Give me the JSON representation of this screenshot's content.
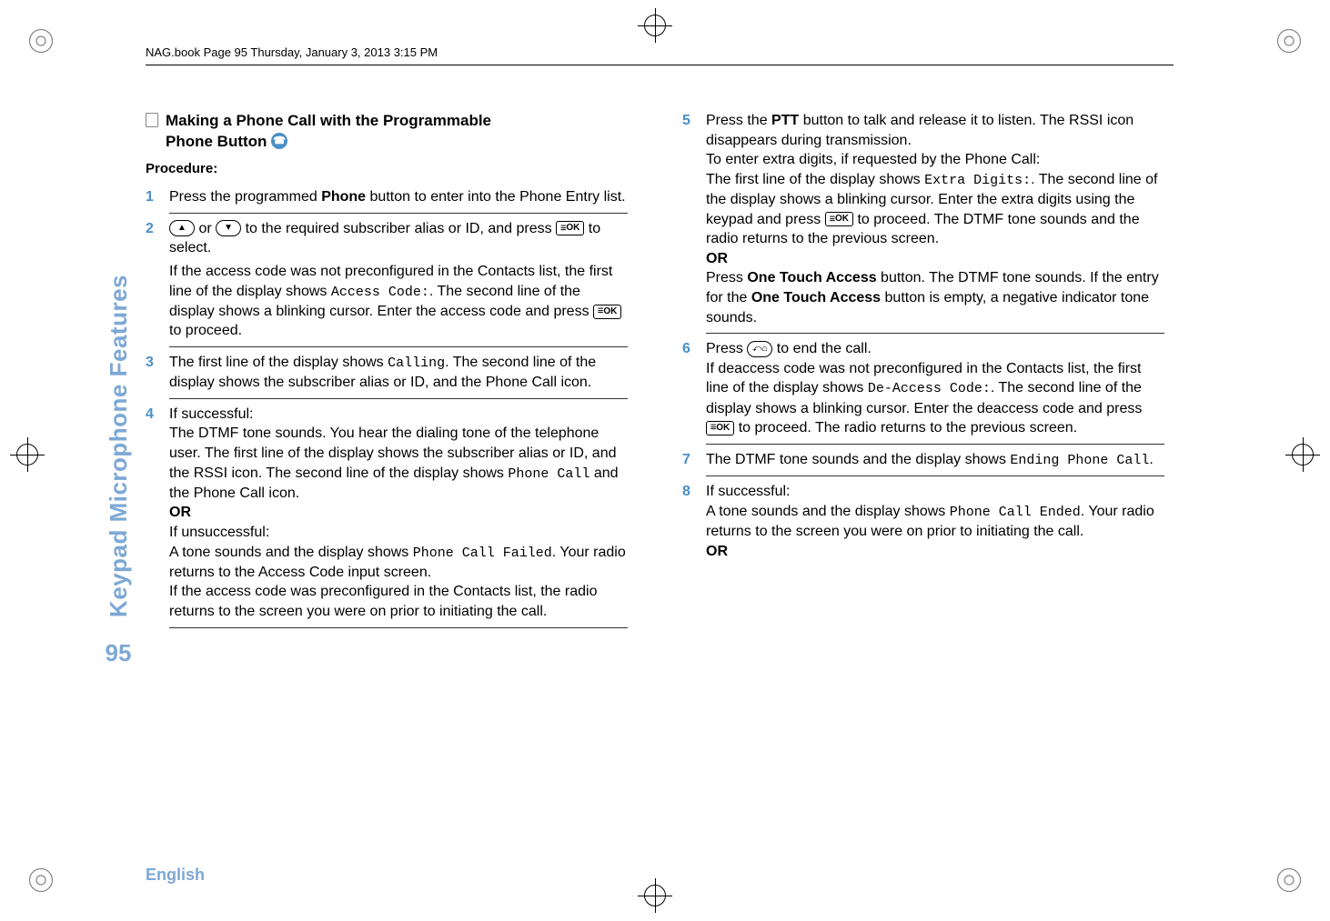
{
  "header": {
    "running_head": "NAG.book  Page 95  Thursday, January 3, 2013  3:15 PM"
  },
  "sidebar": {
    "label": "Keypad Microphone Features",
    "page_number": "95"
  },
  "footer": {
    "language": "English"
  },
  "left": {
    "title_line1": "Making a Phone Call with the Programmable",
    "title_line2": "Phone Button",
    "procedure_label": "Procedure:",
    "steps": {
      "s1": {
        "num": "1",
        "a": "Press the programmed ",
        "b_bold": "Phone",
        "c": " button to enter into the Phone Entry list."
      },
      "s2": {
        "num": "2",
        "p1a": " or ",
        "p1b": " to the required subscriber alias or ID, and press ",
        "p1c": " to select.",
        "p2a": "If the access code was not preconfigured in the Contacts list, the first line of the display shows ",
        "p2_code": "Access Code:",
        "p2b": ". The second line of the display shows a blinking cursor. Enter the access code and press ",
        "p2c": " to proceed."
      },
      "s3": {
        "num": "3",
        "a": "The first line of the display shows ",
        "code": "Calling",
        "b": ". The second line of the display shows the subscriber alias or ID, and the Phone Call icon."
      },
      "s4": {
        "num": "4",
        "heading": "If successful:",
        "p1a": "The DTMF tone sounds. You hear the dialing tone of the telephone user. The first line of the display shows the subscriber alias or ID, and the RSSI icon. The second line of the display shows ",
        "p1_code": "Phone Call",
        "p1b": " and the Phone Call icon.",
        "or": "OR",
        "p2_heading": "If unsuccessful:",
        "p3a": "A tone sounds and the display shows ",
        "p3_code": "Phone Call Failed",
        "p3b": ". Your radio returns to the Access Code input screen.",
        "p4": "If the access code was preconfigured in the Contacts list, the radio returns to the screen you were on prior to initiating the call."
      }
    }
  },
  "right": {
    "steps": {
      "s5": {
        "num": "5",
        "p1a": "Press the ",
        "p1_bold": "PTT",
        "p1b": " button to talk and release it to listen. The RSSI icon disappears during transmission.",
        "p2": "To enter extra digits, if requested by the Phone Call:",
        "p3a": "The first line of the display shows ",
        "p3_code": "Extra Digits:",
        "p3b": ". The second line of the display shows a blinking cursor. Enter the extra digits using the keypad and press ",
        "p3c": " to proceed. The DTMF tone sounds and the radio returns to the previous screen.",
        "or": "OR",
        "p4a": "Press ",
        "p4_bold": "One Touch Access",
        "p4b": " button. The DTMF tone sounds. If the entry for the ",
        "p4_bold2": "One Touch Access",
        "p4c": " button is empty, a negative indicator tone sounds."
      },
      "s6": {
        "num": "6",
        "p1a": "Press ",
        "p1b": " to end the call.",
        "p2a": "If deaccess code was not preconfigured in the Contacts list, the first line of the display shows ",
        "p2_code": "De-Access Code:",
        "p2b": ". The second line of the display shows a blinking cursor. Enter the deaccess code and press ",
        "p2c": " to proceed. The radio returns to the previous screen."
      },
      "s7": {
        "num": "7",
        "a": "The DTMF tone sounds and the display shows ",
        "code": "Ending Phone Call",
        "b": "."
      },
      "s8": {
        "num": "8",
        "heading": "If successful:",
        "p1a": "A tone sounds and the display shows ",
        "p1_code": "Phone Call Ended",
        "p1b": ". Your radio returns to the screen you were on prior to initiating the call.",
        "or": "OR"
      }
    }
  },
  "keys": {
    "ok": "OK",
    "up": "▲",
    "down": "▼",
    "end": "⤺⌂"
  }
}
